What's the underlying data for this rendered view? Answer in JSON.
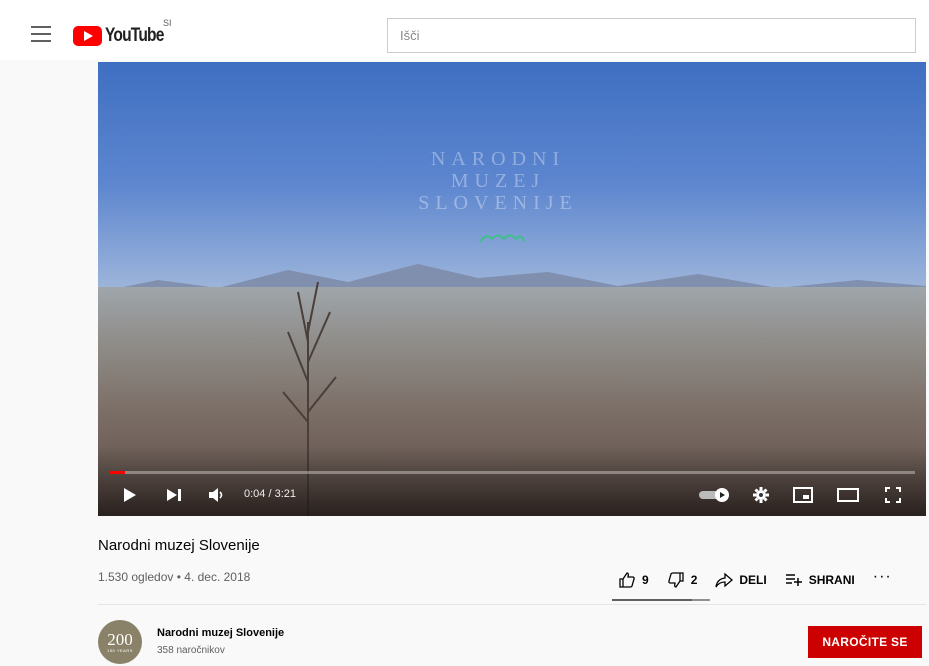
{
  "header": {
    "logo_text": "YouTube",
    "country_code": "SI",
    "search_placeholder": "Išči"
  },
  "player": {
    "overlay_title": [
      "NARODNI",
      "MUZEJ",
      "SLOVENIJE"
    ],
    "current_time": "0:04",
    "duration": "3:21",
    "time_display": "0:04 / 3:21",
    "progress_fraction": 0.02,
    "autoplay_on": true
  },
  "video": {
    "title": "Narodni muzej Slovenije",
    "meta": "1.530 ogledov • 4. dec. 2018",
    "likes": "9",
    "dislikes": "2",
    "share_label": "DELI",
    "save_label": "SHRANI",
    "more_label": "···",
    "like_ratio": 0.82
  },
  "channel": {
    "name": "Narodni muzej Slovenije",
    "subscribers": "358 naročnikov",
    "avatar_text": "200",
    "avatar_subtext": "150 YEARS",
    "subscribe_label": "NAROČITE SE"
  },
  "colors": {
    "brand_red": "#ff0000",
    "subscribe_red": "#cc0000",
    "progress_red": "#ff0000"
  }
}
